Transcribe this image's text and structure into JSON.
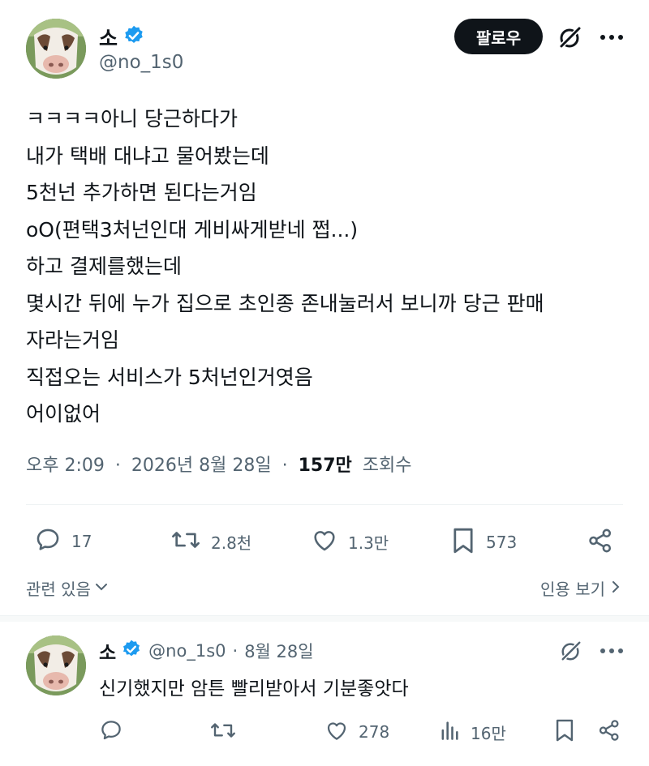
{
  "tweet": {
    "author": {
      "display_name": "소",
      "handle": "@no_1s0",
      "verified": true
    },
    "follow_label": "팔로우",
    "body_lines": [
      "ㅋㅋㅋㅋ아니 당근하다가",
      "내가 택배 대냐고 물어봤는데",
      "5천넌 추가하면 된다는거임",
      "oO(편택3처넌인대 게비싸게받네 쩝...)",
      "하고 결제를했는데",
      "몇시간 뒤에 누가 집으로 초인종 존내눌러서 보니까 당근 판매",
      "자라는거임",
      "직접오는 서비스가 5처넌인거엿음",
      "어이없어"
    ],
    "time": "오후 2:09",
    "date": "2026년 8월 28일",
    "views_count": "157만",
    "views_label": "조회수",
    "separator": "·",
    "actions": {
      "replies": "17",
      "retweets": "2.8천",
      "likes": "1.3만",
      "bookmarks": "573"
    },
    "related_label": "관련 있음",
    "quotes_label": "인용 보기"
  },
  "reply": {
    "author": {
      "display_name": "소",
      "handle": "@no_1s0",
      "verified": true
    },
    "separator": "·",
    "date": "8월 28일",
    "text": "신기했지만 암튼 빨리받아서 기분좋앗다",
    "actions": {
      "likes": "278",
      "views": "16만"
    }
  },
  "colors": {
    "text": "#0f1419",
    "secondary": "#536471",
    "verified": "#1d9bf0",
    "button_bg": "#0f1419"
  }
}
